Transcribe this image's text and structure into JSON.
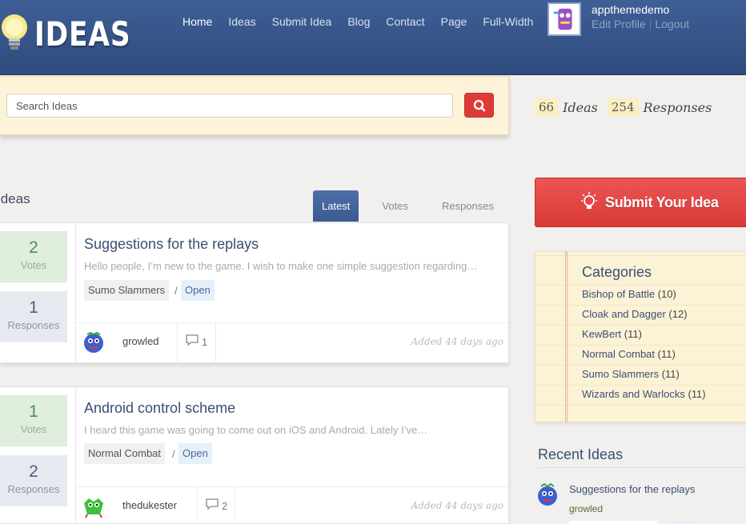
{
  "header": {
    "logo_text": "IDEAS",
    "nav": [
      "Home",
      "Ideas",
      "Submit Idea",
      "Blog",
      "Contact",
      "Page",
      "Full-Width"
    ],
    "active_nav": "Home",
    "username": "appthemedemo",
    "edit_profile": "Edit Profile",
    "separator": "|",
    "logout": "Logout"
  },
  "search": {
    "placeholder": "Search Ideas",
    "button_icon": "search-icon"
  },
  "stats": {
    "ideas_count": "66",
    "ideas_label": "Ideas",
    "responses_count": "254",
    "responses_label": "Responses"
  },
  "main": {
    "title": "Ideas",
    "tabs": [
      "Latest",
      "Votes",
      "Responses"
    ],
    "active_tab": "Latest",
    "ideas": [
      {
        "votes": "2",
        "votes_label": "Votes",
        "responses": "1",
        "responses_label": "Responses",
        "title": "Suggestions for the replays",
        "excerpt": "Hello people, I’m new to the game. I wish to make one simple suggestion regarding…",
        "category": "Sumo Slammers",
        "tag_sep": "/",
        "status": "Open",
        "author": "growled",
        "comments": "1",
        "added": "Added 44 days ago"
      },
      {
        "votes": "1",
        "votes_label": "Votes",
        "responses": "2",
        "responses_label": "Responses",
        "title": "Android control scheme",
        "excerpt": "I heard this game was going to come out on iOS and Android. Lately I’ve…",
        "category": "Normal Combat",
        "tag_sep": "/",
        "status": "Open",
        "author": "thedukester",
        "comments": "2",
        "added": "Added 44 days ago"
      }
    ]
  },
  "sidebar": {
    "submit_label": "Submit Your Idea",
    "categories_title": "Categories",
    "categories": [
      {
        "name": "Bishop of Battle",
        "count": "(10)"
      },
      {
        "name": "Cloak and Dagger",
        "count": "(12)"
      },
      {
        "name": "KewBert",
        "count": "(11)"
      },
      {
        "name": "Normal Combat",
        "count": "(11)"
      },
      {
        "name": "Sumo Slammers",
        "count": "(11)"
      },
      {
        "name": "Wizards and Warlocks",
        "count": "(11)"
      }
    ],
    "recent_title": "Recent Ideas",
    "recent": [
      {
        "title": "Suggestions for the replays",
        "author": "growled"
      }
    ]
  },
  "colors": {
    "header": "#3e5f96",
    "accent_red": "#de3b37",
    "link_blue": "#3a4e72",
    "notepad": "#fcf3d7"
  }
}
